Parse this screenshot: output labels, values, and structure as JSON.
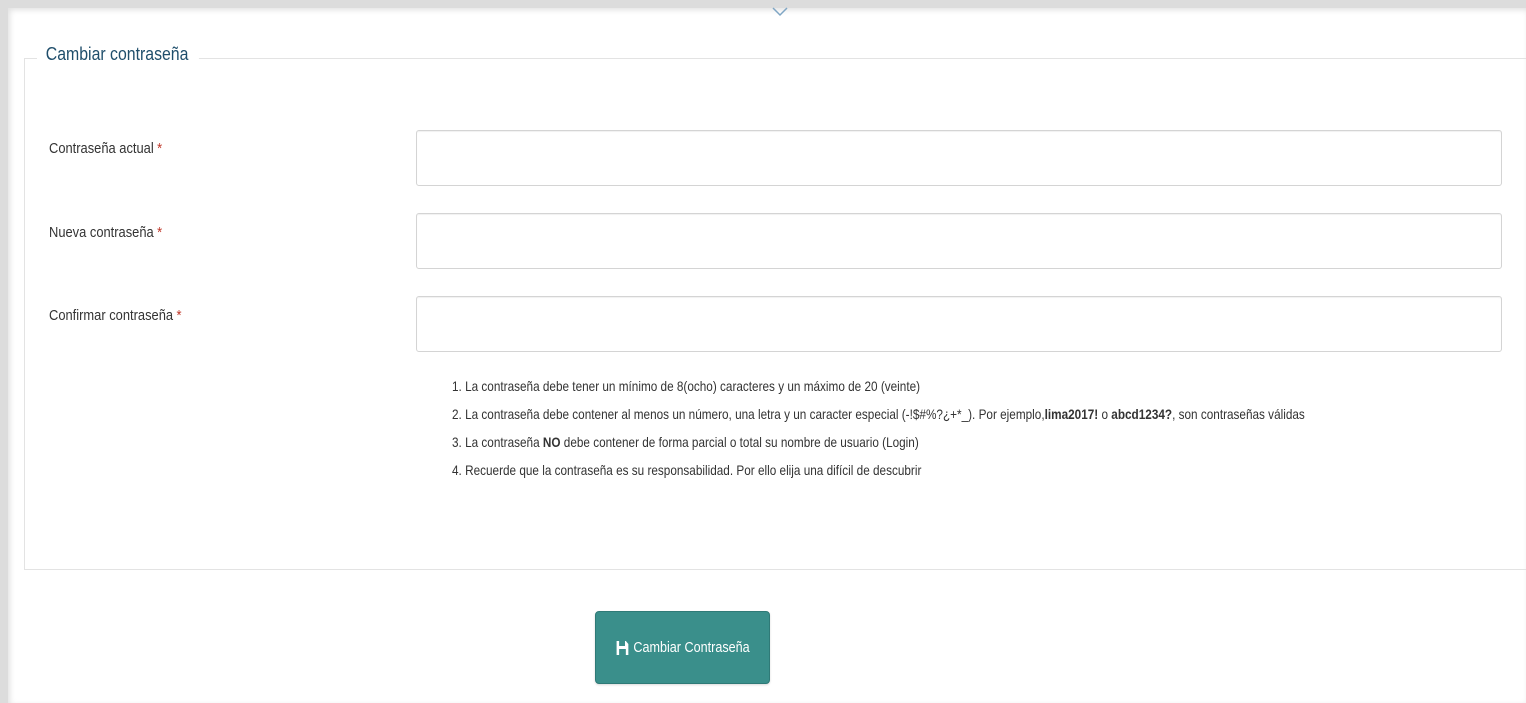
{
  "form": {
    "legend": "Cambiar contraseña",
    "required_mark": "*",
    "fields": [
      {
        "label": "Contraseña actual",
        "value": "",
        "placeholder": ""
      },
      {
        "label": "Nueva contraseña",
        "value": "",
        "placeholder": ""
      },
      {
        "label": "Confirmar contraseña",
        "value": "",
        "placeholder": ""
      }
    ],
    "rules": {
      "r1": "1. La contraseña debe tener un mínimo de 8(ocho) caracteres y un máximo de 20 (veinte)",
      "r2_a": "2. La contraseña debe contener al menos un número, una letra y un caracter especial (-!$#%?¿+*_). Por ejemplo,",
      "r2_b": "lima2017!",
      "r2_c": " o ",
      "r2_d": "abcd1234?",
      "r2_e": ", son contraseñas válidas",
      "r3_a": "3. La contraseña ",
      "r3_b": "NO",
      "r3_c": " debe contener de forma parcial o total su nombre de usuario (Login)",
      "r4": "4. Recuerde que la contraseña es su responsabilidad. Por ello elija una difícil de descubrir"
    },
    "submit_label": "Cambiar Contraseña",
    "submit_icon": "save-icon"
  },
  "colors": {
    "legend": "#1f4e6b",
    "required": "#c0392b",
    "button": "#3a8f8b"
  }
}
